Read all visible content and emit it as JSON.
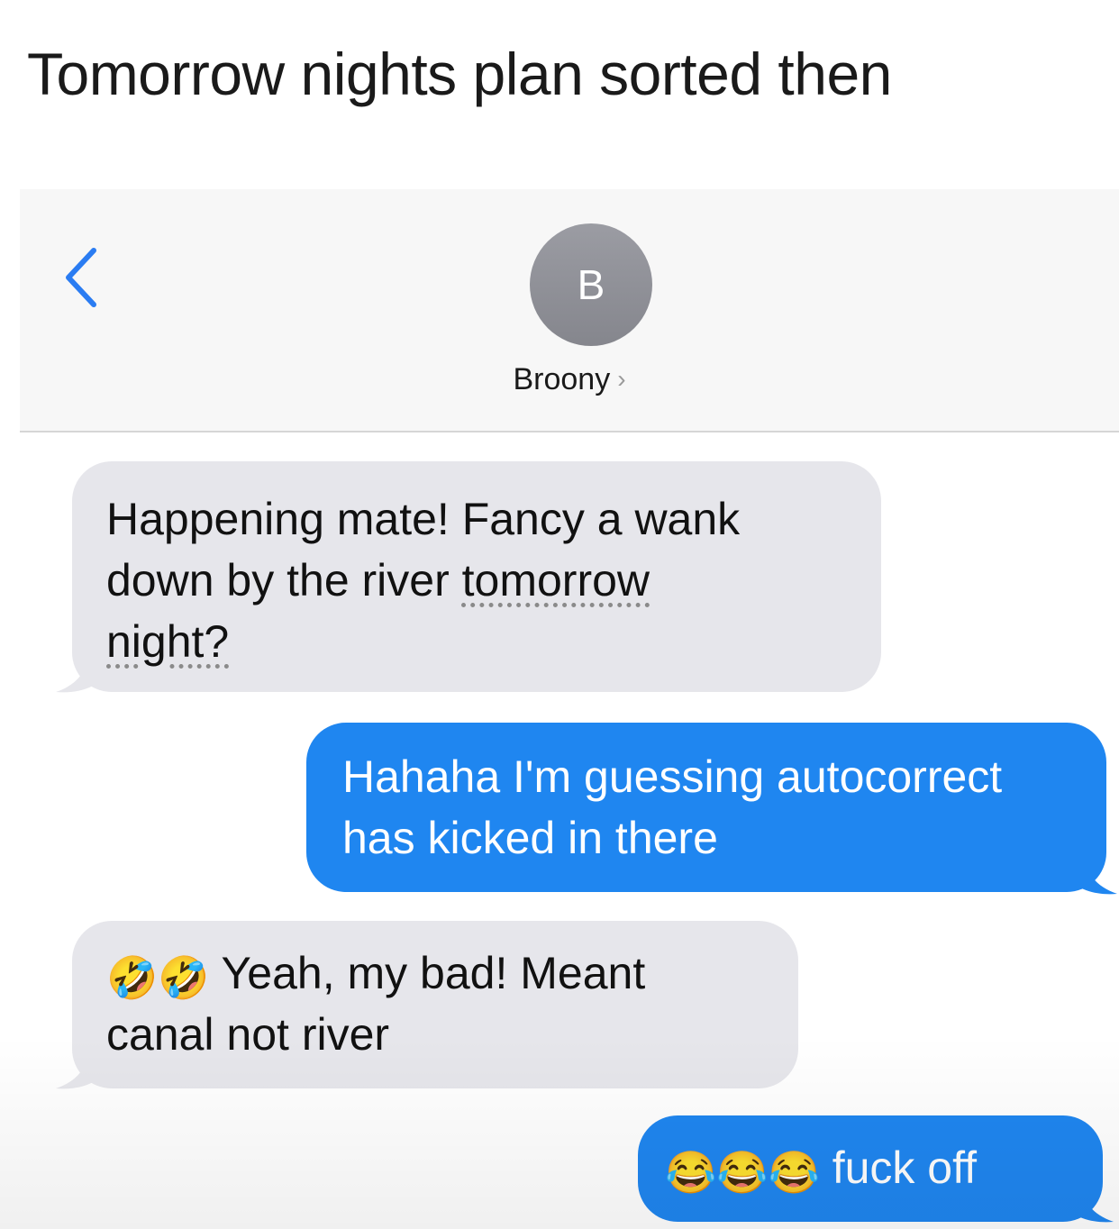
{
  "caption": "Tomorrow nights plan sorted then",
  "header": {
    "back_icon": "chevron-left-icon",
    "avatar_initial": "B",
    "contact_name": "Broony",
    "contact_chevron": "›"
  },
  "messages": [
    {
      "direction": "received",
      "text_before": "Happening mate! Fancy a wank down by the river ",
      "underlined_1": "tomorrow",
      "line_break_text": "",
      "underlined_2": "night?"
    },
    {
      "direction": "sent",
      "text": "Hahaha I'm guessing autocorrect has kicked in there"
    },
    {
      "direction": "received",
      "emojis": "🤣🤣",
      "text": " Yeah, my bad! Meant canal not river"
    },
    {
      "direction": "sent",
      "emojis": "😂😂😂",
      "text": " fuck off"
    }
  ],
  "colors": {
    "sent_bubble": "#1f86f0",
    "received_bubble": "#e6e6eb",
    "ios_blue": "#2a7cf2",
    "avatar_gray": "#8e8f96"
  }
}
